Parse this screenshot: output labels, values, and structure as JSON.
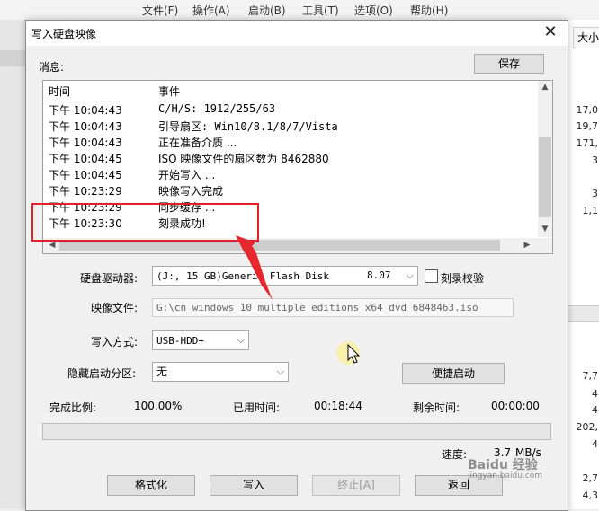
{
  "background_app": {
    "menu": [
      "文件(F)",
      "操作(A)",
      "启动(B)",
      "工具(T)",
      "选项(O)",
      "帮助(H)"
    ],
    "column_header": "大小",
    "numbers": [
      "17,0",
      "19,7",
      "171,",
      "3",
      "3",
      "1,1",
      "7,7",
      "4",
      "4",
      "202,",
      "4",
      "2,7",
      "4,3"
    ]
  },
  "dialog": {
    "title": "写入硬盘映像",
    "message_label": "消息:",
    "save_button": "保存",
    "log": {
      "col_time": "时间",
      "col_event": "事件",
      "rows": [
        {
          "time": "下午 10:04:43",
          "event": "C/H/S: 1912/255/63"
        },
        {
          "time": "下午 10:04:43",
          "event": "引导扇区: Win10/8.1/8/7/Vista"
        },
        {
          "time": "下午 10:04:43",
          "event": "正在准备介质 ..."
        },
        {
          "time": "下午 10:04:45",
          "event": "ISO 映像文件的扇区数为 8462880"
        },
        {
          "time": "下午 10:04:45",
          "event": "开始写入 ..."
        },
        {
          "time": "下午 10:23:29",
          "event": "映像写入完成"
        },
        {
          "time": "下午 10:23:29",
          "event": "同步缓存 ..."
        },
        {
          "time": "下午 10:23:30",
          "event": "刻录成功!"
        }
      ]
    },
    "drive_label": "硬盘驱动器:",
    "drive_value": "(J:, 15 GB)Generic Flash Disk",
    "drive_size": "8.07",
    "verify_label": "刻录校验",
    "image_label": "映像文件:",
    "image_value": "G:\\cn_windows_10_multiple_editions_x64_dvd_6848463.iso",
    "write_mode_label": "写入方式:",
    "write_mode_value": "USB-HDD+",
    "hidden_partition_label": "隐藏启动分区:",
    "hidden_partition_value": "无",
    "quick_boot_button": "便捷启动",
    "completion_label": "完成比例:",
    "completion_value": "100.00%",
    "elapsed_label": "已用时间:",
    "elapsed_value": "00:18:44",
    "remaining_label": "剩余时间:",
    "remaining_value": "00:00:00",
    "progress_fraction": 0.0,
    "speed_label": "速度:",
    "speed_value": "3.7",
    "speed_unit": "MB/s",
    "buttons": {
      "format": "格式化",
      "write": "写入",
      "stop": "终止[A]",
      "back": "返回"
    }
  },
  "watermark": {
    "brand": "Baidu 经验",
    "url": "jingyan.baidu.com"
  },
  "colors": {
    "highlight": "#e0202a",
    "progress": "#06b025"
  }
}
